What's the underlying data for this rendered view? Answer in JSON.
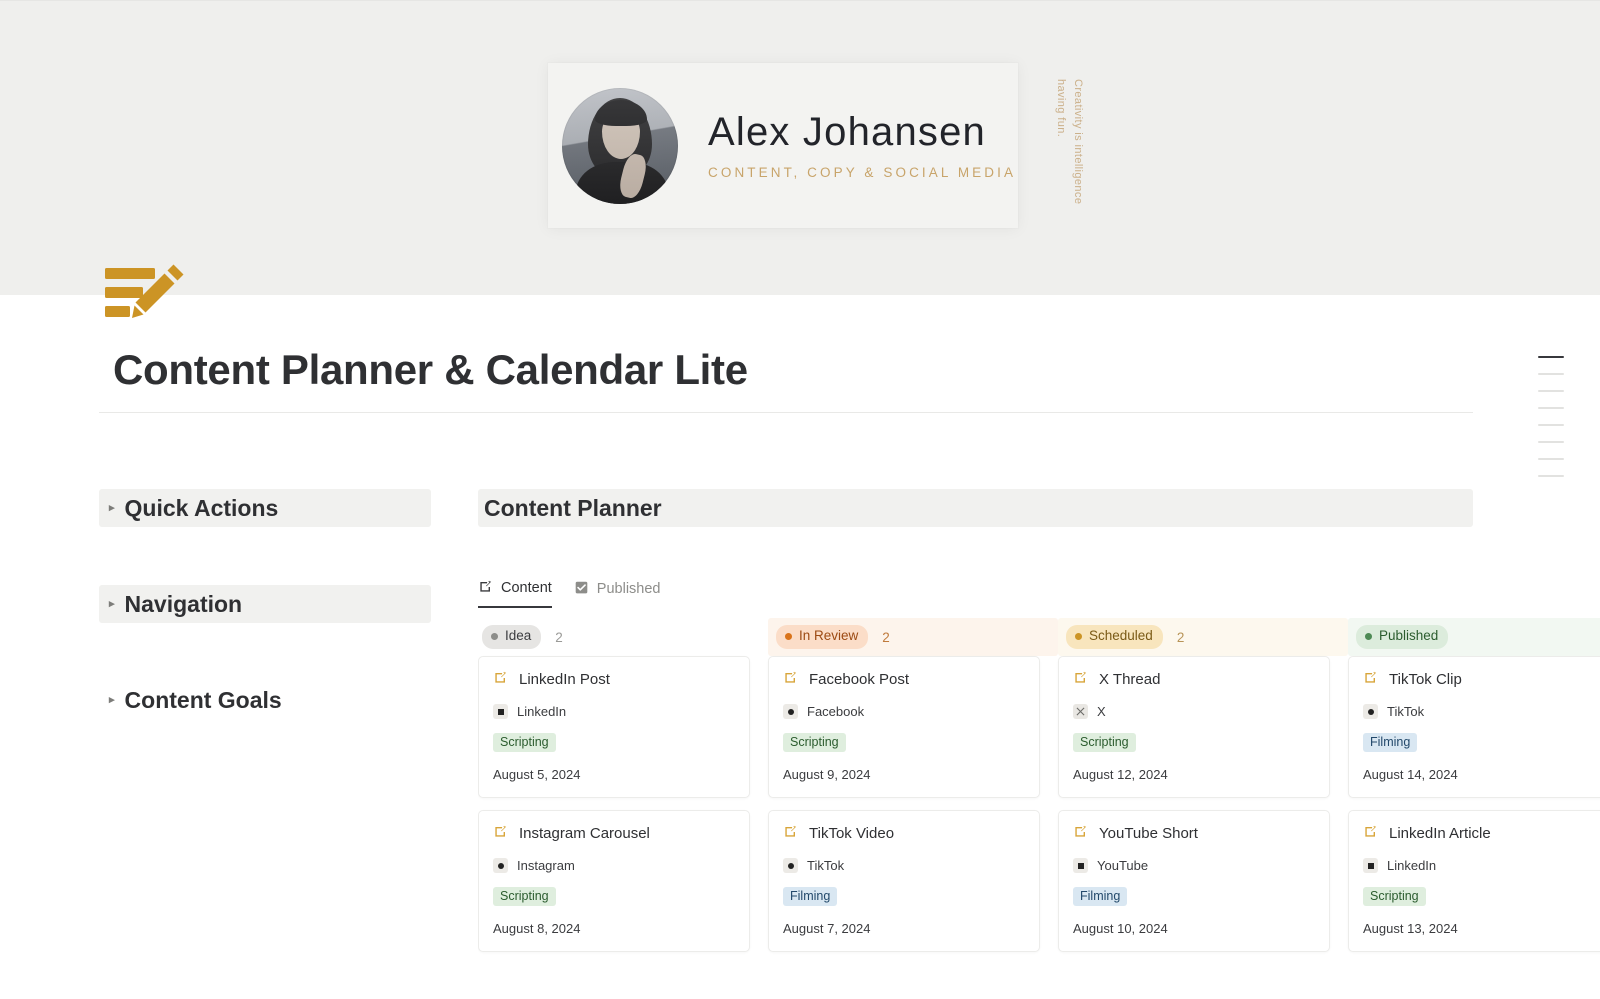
{
  "cover": {
    "profile": {
      "name": "Alex Johansen",
      "tagline": "CONTENT, COPY & SOCIAL MEDIA",
      "avatar_alt": "portrait-photo"
    },
    "quote": "Creativity is intelligence having fun."
  },
  "document": {
    "logo_icon": "note-edit-icon",
    "title": "Content Planner & Calendar Lite"
  },
  "left_column": {
    "toggles": [
      {
        "label": "Quick Actions",
        "shaded": true
      },
      {
        "label": "Navigation",
        "shaded": true
      },
      {
        "label": "Content Goals",
        "shaded": false
      }
    ]
  },
  "database": {
    "title": "Content Planner",
    "tabs": [
      {
        "label": "Content",
        "icon": "edit-square-icon",
        "active": true
      },
      {
        "label": "Published",
        "icon": "checkbox-checked-icon",
        "active": false
      }
    ]
  },
  "colors": {
    "accent_gold": "#cc9425",
    "cover_bg": "#efefed",
    "idea_chip_bg": "#e6e5e3",
    "idea_dot": "#8d8d8a",
    "review_chip_bg": "#fbddc8",
    "review_dot": "#d9731a",
    "review_col_bg": "#fdf4ec",
    "scheduled_chip_bg": "#f8e5bd",
    "scheduled_dot": "#cc9425",
    "scheduled_col_bg": "#fdf8ee",
    "published_chip_bg": "#dcecdc",
    "published_dot": "#4e8a55",
    "published_col_bg": "#f2f8f2",
    "tag_green_bg": "#dfeede",
    "tag_blue_bg": "#d9e7f2"
  },
  "board": {
    "columns": [
      {
        "name": "Idea",
        "count": "2",
        "chip_bg": "#e6e5e3",
        "chip_text": "#3b3c3f",
        "dot": "#8d8d8a",
        "col_bg": "transparent",
        "count_color": "#9a9a97",
        "cards": [
          {
            "title": "LinkedIn Post",
            "platform": "LinkedIn",
            "platform_icon": "square-glyph",
            "tag": "Scripting",
            "tag_style": "green",
            "date": "August 5, 2024"
          },
          {
            "title": "Instagram Carousel",
            "platform": "Instagram",
            "platform_icon": "circle-glyph",
            "tag": "Scripting",
            "tag_style": "green",
            "date": "August 8, 2024"
          }
        ]
      },
      {
        "name": "In Review",
        "count": "2",
        "chip_bg": "#fbddc8",
        "chip_text": "#9c4a13",
        "dot": "#d9731a",
        "col_bg": "#fdf4ec",
        "count_color": "#c07a3c",
        "cards": [
          {
            "title": "Facebook Post",
            "platform": "Facebook",
            "platform_icon": "circle-glyph",
            "tag": "Scripting",
            "tag_style": "green",
            "date": "August 9, 2024"
          },
          {
            "title": "TikTok Video",
            "platform": "TikTok",
            "platform_icon": "circle-glyph",
            "tag": "Filming",
            "tag_style": "blue",
            "date": "August 7, 2024"
          }
        ]
      },
      {
        "name": "Scheduled",
        "count": "2",
        "chip_bg": "#f8e5bd",
        "chip_text": "#7a5a16",
        "dot": "#cc9425",
        "col_bg": "#fdf8ee",
        "count_color": "#b89457",
        "cards": [
          {
            "title": "X Thread",
            "platform": "X",
            "platform_icon": "x-glyph",
            "tag": "Scripting",
            "tag_style": "green",
            "date": "August 12, 2024"
          },
          {
            "title": "YouTube Short",
            "platform": "YouTube",
            "platform_icon": "square-glyph",
            "tag": "Filming",
            "tag_style": "blue",
            "date": "August 10, 2024"
          }
        ]
      },
      {
        "name": "Published",
        "count": "",
        "chip_bg": "#dcecdc",
        "chip_text": "#2b5c2e",
        "dot": "#4e8a55",
        "col_bg": "#f2f8f2",
        "count_color": "#6f9a72",
        "cards": [
          {
            "title": "TikTok Clip",
            "platform": "TikTok",
            "platform_icon": "circle-glyph",
            "tag": "Filming",
            "tag_style": "blue",
            "date": "August 14, 2024"
          },
          {
            "title": "LinkedIn Article",
            "platform": "LinkedIn",
            "platform_icon": "square-glyph",
            "tag": "Scripting",
            "tag_style": "green",
            "date": "August 13, 2024"
          }
        ]
      }
    ]
  },
  "minimap": {
    "items": [
      {
        "active": true
      },
      {
        "active": false
      },
      {
        "active": false
      },
      {
        "active": false
      },
      {
        "active": false
      },
      {
        "active": false
      },
      {
        "active": false
      },
      {
        "active": false
      }
    ]
  }
}
